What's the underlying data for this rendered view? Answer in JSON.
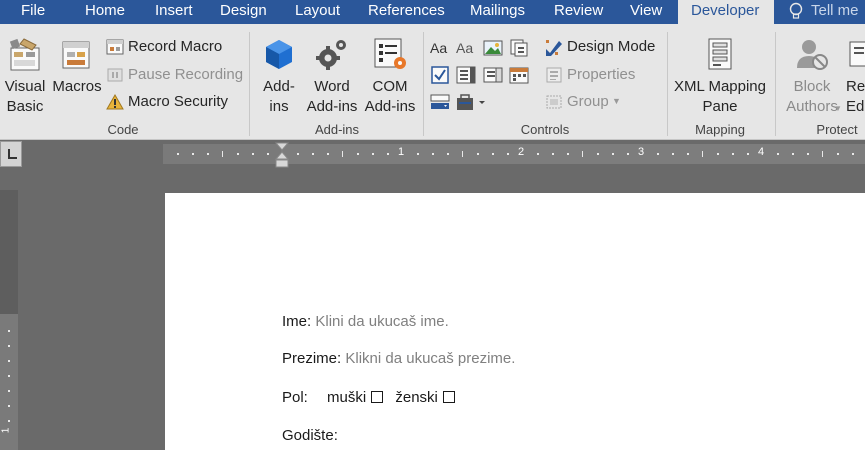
{
  "tabs": [
    "File",
    "Home",
    "Insert",
    "Design",
    "Layout",
    "References",
    "Mailings",
    "Review",
    "View",
    "Developer"
  ],
  "active_tab": "Developer",
  "tell_me": "Tell me",
  "colors": {
    "accent": "#2b579a",
    "ribbon": "#e6e6e6",
    "workspace": "#6a6a6a"
  },
  "groups": {
    "code": {
      "label": "Code",
      "visual_basic": [
        "Visual",
        "Basic"
      ],
      "macros": "Macros",
      "record_macro": "Record Macro",
      "pause_recording": "Pause Recording",
      "macro_security": "Macro Security"
    },
    "addins": {
      "label": "Add-ins",
      "addins": [
        "Add-",
        "ins"
      ],
      "word_addins": [
        "Word",
        "Add-ins"
      ],
      "com_addins": [
        "COM",
        "Add-ins"
      ]
    },
    "controls": {
      "label": "Controls",
      "design_mode": "Design Mode",
      "properties": "Properties",
      "group": "Group"
    },
    "mapping": {
      "label": "Mapping",
      "xml_mapping": [
        "XML Mapping",
        "Pane"
      ]
    },
    "protect": {
      "label": "Protect",
      "block_authors": [
        "Block",
        "Authors"
      ],
      "restrict": [
        "Re",
        "Ed"
      ]
    }
  },
  "ruler": {
    "numbers": [
      "1",
      "2",
      "3",
      "4"
    ],
    "vertical_numbers": [
      "1"
    ]
  },
  "document": {
    "ime_label": "Ime:",
    "ime_placeholder": "Klini da ukucaš ime.",
    "prezime_label": "Prezime:",
    "prezime_placeholder": "Klikni da ukucaš prezime.",
    "pol_label": "Pol:",
    "muski": "muški",
    "zenski": "ženski",
    "godiste_label": "Godište:"
  }
}
